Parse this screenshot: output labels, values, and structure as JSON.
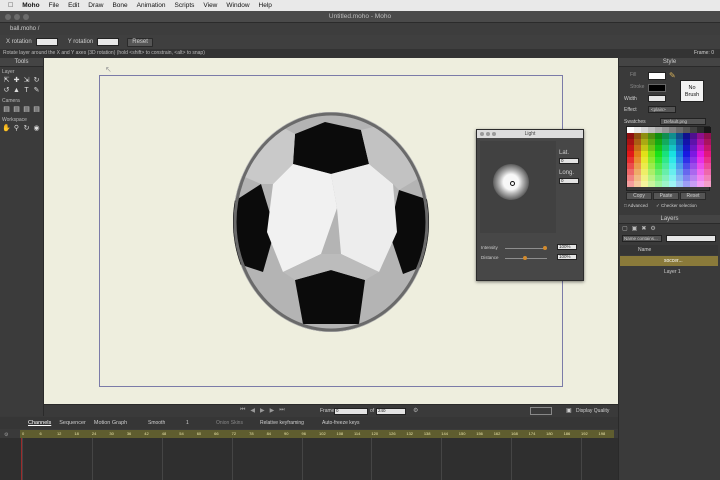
{
  "menubar": {
    "app": "Moho",
    "items": [
      "File",
      "Edit",
      "Draw",
      "Bone",
      "Animation",
      "Scripts",
      "View",
      "Window",
      "Help"
    ]
  },
  "window": {
    "title": "Untitled.moho - Moho"
  },
  "file_tab": "ball.moho",
  "options": {
    "x_rotation_label": "X rotation",
    "y_rotation_label": "Y rotation",
    "reset": "Reset"
  },
  "hint": "Rotate layer around the X and Y axes (3D rotation) (hold <shift> to constrain, <alt> to snap)",
  "frame_indicator": "Frame: 0",
  "tools": {
    "title": "Tools",
    "layer": "Layer",
    "camera": "Camera",
    "workspace": "Workspace"
  },
  "light": {
    "title": "Light",
    "lat_label": "Lat.",
    "lat": "0",
    "long_label": "Long.",
    "long": "0",
    "intensity_label": "Intensity",
    "intensity": "100%",
    "distance_label": "Distance",
    "distance": "100%"
  },
  "style": {
    "title": "Style",
    "fill": "Fill",
    "stroke": "Stroke",
    "width": "Width",
    "effect": "Effect",
    "effect_value": "<plain>",
    "no_brush": "No Brush",
    "swatches_label": "Swatches",
    "swatches_value": "Default.png",
    "copy": "Copy",
    "paste": "Paste",
    "reset": "Reset",
    "advanced": "Advanced",
    "checker": "Checker selection"
  },
  "layers": {
    "title": "Layers",
    "filter": "Name contains...",
    "name_col": "Name",
    "rows": [
      "soccer...",
      "Layer 1"
    ]
  },
  "transport": {
    "frame_label": "Frame",
    "frame": "0",
    "of": "of",
    "total": "240",
    "quality": "Display Quality"
  },
  "timeline": {
    "tabs": [
      "Channels",
      "Sequencer",
      "Motion Graph"
    ],
    "smooth": "Smooth",
    "step": "1",
    "onion": "Onion Skins",
    "relative": "Relative keyframing",
    "autofreeze": "Auto-freeze keys",
    "ticks": [
      "0",
      "6",
      "12",
      "18",
      "24",
      "30",
      "36",
      "42",
      "48",
      "54",
      "60",
      "66",
      "72",
      "78",
      "84",
      "90",
      "96",
      "102",
      "108",
      "114",
      "120",
      "126",
      "132",
      "138",
      "144",
      "150",
      "156",
      "162",
      "168",
      "174",
      "180",
      "186",
      "192",
      "198"
    ]
  },
  "colors": {
    "canvas": "#eeeede",
    "frame": "#7b7ba8",
    "ruler": "#5f5d2f",
    "accent": "#d28a2d"
  }
}
